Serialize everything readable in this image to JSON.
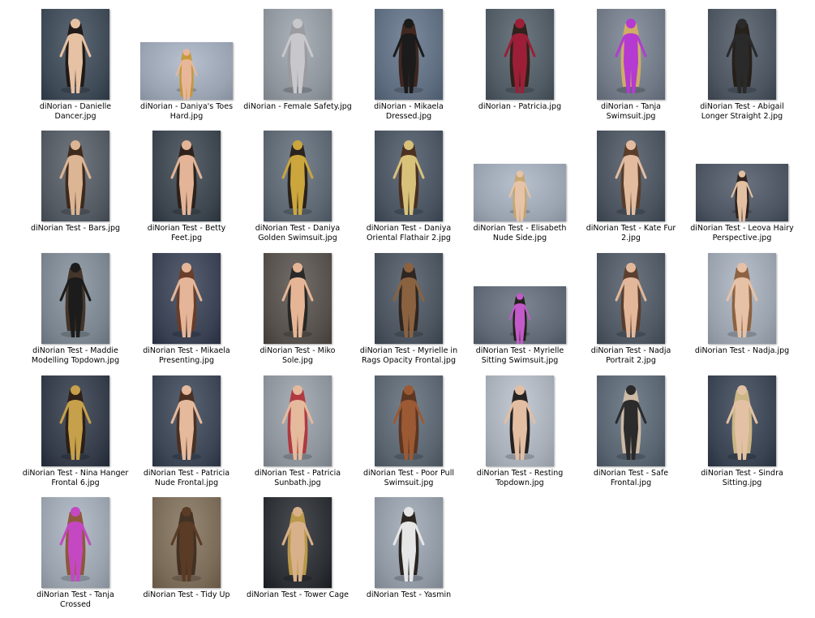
{
  "files": [
    {
      "name": "diNorian - Danielle Dancer.jpg",
      "orientation": "portrait",
      "bg": "#3f4a57",
      "fig": "#e6c1a3",
      "hair": "#1c1410"
    },
    {
      "name": "diNorian - Daniya's Toes Hard.jpg",
      "orientation": "landscape",
      "bg": "#9aa3b2",
      "fig": "#e8b79a",
      "hair": "#c9962b"
    },
    {
      "name": "diNorian - Female Safety.jpg",
      "orientation": "portrait",
      "bg": "#8e959c",
      "fig": "#c8c8cc",
      "hair": "#9a9aa0"
    },
    {
      "name": "diNorian - Mikaela Dressed.jpg",
      "orientation": "portrait",
      "bg": "#5f6d80",
      "fig": "#1b1b1b",
      "hair": "#3a1e14"
    },
    {
      "name": "diNorian - Patricia.jpg",
      "orientation": "portrait",
      "bg": "#515b64",
      "fig": "#9c1f37",
      "hair": "#2b1a12"
    },
    {
      "name": "diNorian - Tanja Swimsuit.jpg",
      "orientation": "portrait",
      "bg": "#707985",
      "fig": "#b43ad1",
      "hair": "#d8b060"
    },
    {
      "name": "diNorian Test - Abigail Longer Straight 2.jpg",
      "orientation": "portrait",
      "bg": "#4c5560",
      "fig": "#2a2a2a",
      "hair": "#201812"
    },
    {
      "name": "diNorian Test - Bars.jpg",
      "orientation": "portrait",
      "bg": "#545a62",
      "fig": "#dcb594",
      "hair": "#3a2414"
    },
    {
      "name": "diNorian Test - Betty Feet.jpg",
      "orientation": "portrait",
      "bg": "#3d464f",
      "fig": "#e3b497",
      "hair": "#2a1d14"
    },
    {
      "name": "diNorian Test - Daniya Golden Swimsuit.jpg",
      "orientation": "portrait",
      "bg": "#5d6772",
      "fig": "#caa63d",
      "hair": "#241912"
    },
    {
      "name": "diNorian Test - Daniya Oriental Flathair 2.jpg",
      "orientation": "portrait",
      "bg": "#4a5461",
      "fig": "#d8c27a",
      "hair": "#4a2b18"
    },
    {
      "name": "diNorian Test - Elisabeth Nude Side.jpg",
      "orientation": "landscape",
      "bg": "#9aa3b0",
      "fig": "#e7c3a7",
      "hair": "#c8a56a"
    },
    {
      "name": "diNorian Test - Kate Fur 2.jpg",
      "orientation": "portrait",
      "bg": "#4a535e",
      "fig": "#e3bca0",
      "hair": "#5a3a24"
    },
    {
      "name": "diNorian Test - Leova Hairy Perspective.jpg",
      "orientation": "landscape",
      "bg": "#4c5561",
      "fig": "#e4c0a3",
      "hair": "#2a1d15"
    },
    {
      "name": "diNorian Test - Maddie Modelling Topdown.jpg",
      "orientation": "portrait",
      "bg": "#7b858f",
      "fig": "#1c1c1c",
      "hair": "#3d2a1c"
    },
    {
      "name": "diNorian Test - Mikaela Presenting.jpg",
      "orientation": "portrait",
      "bg": "#3a4254",
      "fig": "#e4b598",
      "hair": "#6b3c24"
    },
    {
      "name": "diNorian Test - Miko Sole.jpg",
      "orientation": "portrait",
      "bg": "#55504b",
      "fig": "#e6b595",
      "hair": "#222"
    },
    {
      "name": "diNorian Test - Myrielle in Rags Opacity Frontal.jpg",
      "orientation": "portrait",
      "bg": "#4b545e",
      "fig": "#8a6240",
      "hair": "#2b1f18"
    },
    {
      "name": "diNorian Test - Myrielle Sitting Swimsuit.jpg",
      "orientation": "landscape",
      "bg": "#5f6874",
      "fig": "#c25ac9",
      "hair": "#1d1612"
    },
    {
      "name": "diNorian Test - Nadja Portrait 2.jpg",
      "orientation": "portrait",
      "bg": "#4f5863",
      "fig": "#e2b79a",
      "hair": "#5b3a26"
    },
    {
      "name": "diNorian Test - Nadja.jpg",
      "orientation": "portrait",
      "bg": "#9aa2ad",
      "fig": "#e6c1a5",
      "hair": "#8a5a34"
    },
    {
      "name": "diNorian Test - Nina Hanger Frontal 6.jpg",
      "orientation": "portrait",
      "bg": "#353c49",
      "fig": "#c6a04a",
      "hair": "#2a1c12"
    },
    {
      "name": "diNorian Test - Patricia Nude Frontal.jpg",
      "orientation": "portrait",
      "bg": "#3c4655",
      "fig": "#e5b99c",
      "hair": "#4a2c1c"
    },
    {
      "name": "diNorian Test - Patricia Sunbath.jpg",
      "orientation": "portrait",
      "bg": "#8c939b",
      "fig": "#e5b99c",
      "hair": "#b32d34"
    },
    {
      "name": "diNorian Test - Poor Pull Swimsuit.jpg",
      "orientation": "portrait",
      "bg": "#5b6570",
      "fig": "#9b5a33",
      "hair": "#5c3018"
    },
    {
      "name": "diNorian Test - Resting Topdown.jpg",
      "orientation": "portrait",
      "bg": "#a7aeb7",
      "fig": "#e3bea2",
      "hair": "#151110"
    },
    {
      "name": "diNorian Test - Safe Frontal.jpg",
      "orientation": "portrait",
      "bg": "#5a6572",
      "fig": "#2b2b2b",
      "hair": "#d8c2a8"
    },
    {
      "name": "diNorian Test - Sindra Sitting.jpg",
      "orientation": "portrait",
      "bg": "#3a4452",
      "fig": "#e2c1a4",
      "hair": "#d8c08a"
    },
    {
      "name": "diNorian Test - Tanja Crossed",
      "orientation": "portrait",
      "bg": "#9aa3ad",
      "fig": "#c448c2",
      "hair": "#8b4f2c"
    },
    {
      "name": "diNorian Test - Tidy Up",
      "orientation": "portrait",
      "bg": "#7a6a58",
      "fig": "#5a3b26",
      "hair": "#3b2a1c"
    },
    {
      "name": "diNorian Test - Tower Cage",
      "orientation": "portrait",
      "bg": "#2c2f33",
      "fig": "#d8b08a",
      "hair": "#c7a24a"
    },
    {
      "name": "diNorian Test - Yasmin",
      "orientation": "portrait",
      "bg": "#8f98a3",
      "fig": "#e6e6e6",
      "hair": "#1f1712"
    }
  ]
}
